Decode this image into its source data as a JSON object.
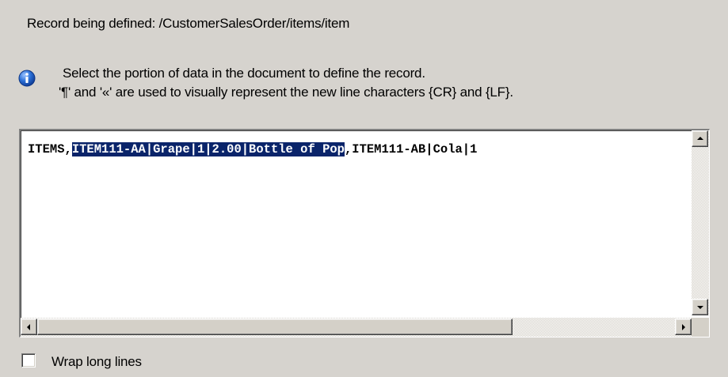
{
  "record": {
    "label": "Record being defined: /CustomerSalesOrder/items/item"
  },
  "info": {
    "icon": "info-icon",
    "line1": "Select the portion of data in the document to define the record.",
    "line2": "'¶' and '«' are used to visually represent the new line characters {CR} and {LF}."
  },
  "document": {
    "prefix": "ITEMS,",
    "selected": "ITEM111-AA|Grape|1|2.00|Bottle of Pop",
    "suffix": ",ITEM111-AB|Cola|1"
  },
  "options": {
    "wrap_label": "Wrap long lines",
    "wrap_checked": false
  },
  "colors": {
    "selection_bg": "#0a246a",
    "selection_fg": "#ffffff",
    "window_bg": "#d6d3ce",
    "info_icon_blue": "#1f5fc8"
  },
  "icons": {
    "scroll_up": "arrow-up-icon",
    "scroll_down": "arrow-down-icon",
    "scroll_left": "arrow-left-icon",
    "scroll_right": "arrow-right-icon"
  }
}
